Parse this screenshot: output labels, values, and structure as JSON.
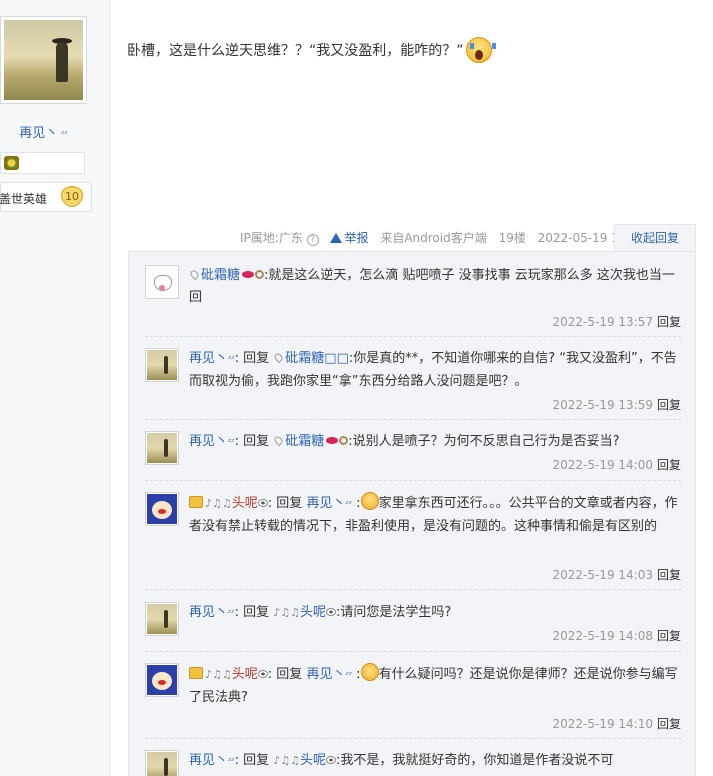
{
  "author": {
    "name": "再见丶",
    "zz": "ᶻᶻ",
    "level_title": "盖世英雄",
    "level_num": "10"
  },
  "post": {
    "text": "卧槽，这是什么逆天思维？？“我又没盈利，能咋的？”",
    "ip_label": "IP属地:广东",
    "help_icon": "?",
    "report": "举报",
    "source": "来自Android客户端",
    "floor": "19楼",
    "time": "2022-05-19 13:53",
    "collapse": "收起回复"
  },
  "reply_label": "回复",
  "replies": [
    {
      "user": "砒霜糖",
      "text": ":就是这么逆天，怎么滴 贴吧喷子 没事找事 云玩家那么多 这次我也当一回",
      "time": "2022-5-19 13:57"
    },
    {
      "user": "再见丶",
      "reply_word": "回复",
      "target": "砒霜糖□□",
      "text": ":你是真的**，不知道你哪来的自信? “我又没盈利”，不告而取视为偷，我跑你家里“拿”东西分给路人没问题是吧？。",
      "time": "2022-5-19 13:59"
    },
    {
      "user": "再见丶",
      "reply_word": "回复",
      "target": "砒霜糖",
      "text": ":说别人是喷子？为何不反思自己行为是否妥当?",
      "time": "2022-5-19 14:00"
    },
    {
      "user": "头呢",
      "notes": "♪♫♫",
      "reply_word": "回复",
      "target": "再见丶",
      "text": "家里拿东西可还行。。。公共平台的文章或者内容，作者没有禁止转载的情况下，非盈利使用，是没有问题的。这种事情和偷是有区别的",
      "time": "2022-5-19 14:03"
    },
    {
      "user": "再见丶",
      "reply_word": "回复",
      "target": "头呢",
      "notes": "♪♫♫",
      "text": ":请问您是法学生吗?",
      "time": "2022-5-19 14:08"
    },
    {
      "user": "头呢",
      "notes": "♪♫♫",
      "reply_word": "回复",
      "target": "再见丶",
      "text": "有什么疑问吗？还是说你是律师？还是说你参与编写了民法典?",
      "time": "2022-5-19 14:10"
    },
    {
      "user": "再见丶",
      "reply_word": "回复",
      "target": "头呢",
      "notes": "♪♫♫",
      "text": ":我不是，我就挺好奇的，你知道是作者没说不可",
      "time": ""
    }
  ]
}
